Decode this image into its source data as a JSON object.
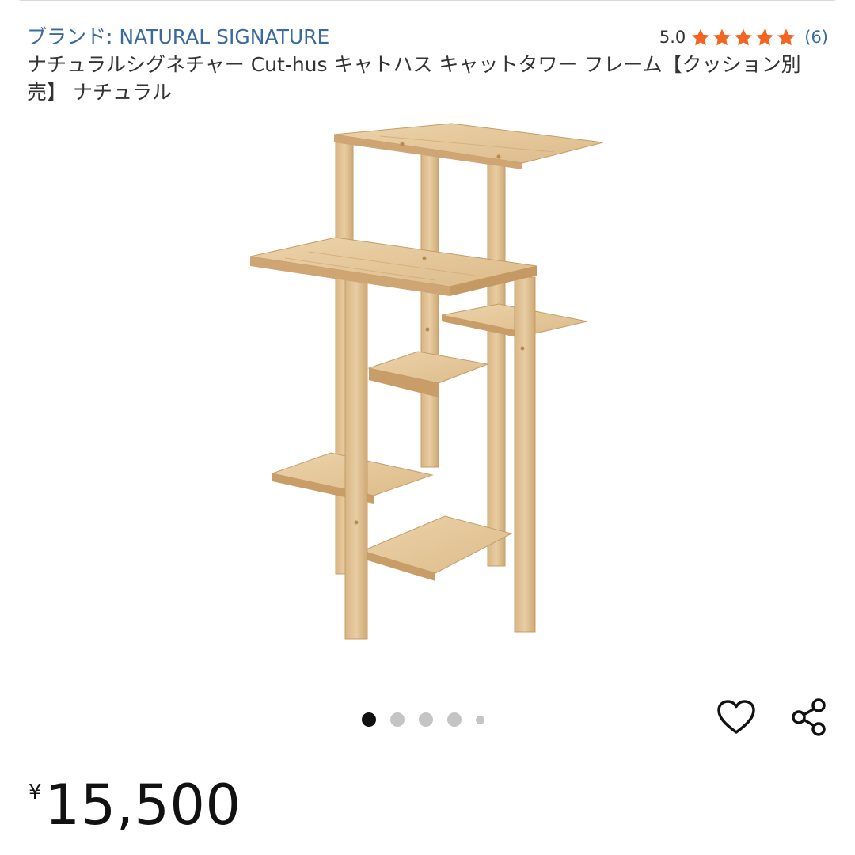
{
  "brand": {
    "label": "ブランド: NATURAL SIGNATURE"
  },
  "rating": {
    "value": "5.0",
    "stars": 5,
    "review_count": "(6)",
    "star_color": "#f26522"
  },
  "product": {
    "title": "ナチュラルシグネチャー Cut-hus キャトハス キャットタワー フレーム【クッション別売】 ナチュラル"
  },
  "gallery": {
    "total_images": 5,
    "active_index": 0
  },
  "actions": {
    "like_icon": "heart-icon",
    "share_icon": "share-icon"
  },
  "price": {
    "currency": "¥",
    "amount": "15,500"
  },
  "colors": {
    "link": "#3a6a9e",
    "text": "#333333",
    "wood_light": "#e3c79d",
    "wood_mid": "#d2ad7b",
    "wood_dark": "#b98d57"
  }
}
